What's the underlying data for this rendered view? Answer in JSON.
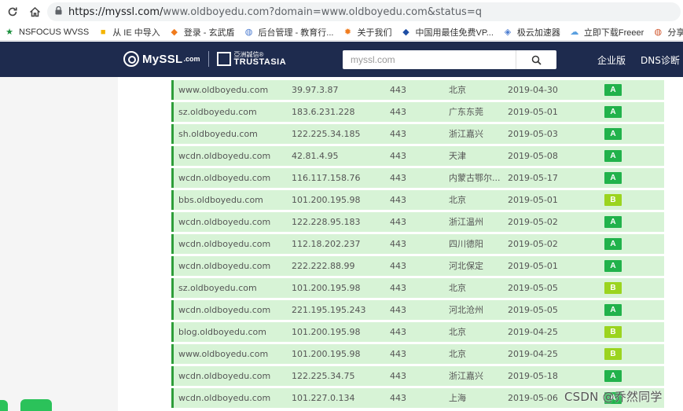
{
  "browser": {
    "url_host": "https://myssl.com/",
    "url_rest": "www.oldboyedu.com?domain=www.oldboyedu.com&status=q"
  },
  "bookmarks": [
    {
      "label": "NSFOCUS WVSS",
      "icon": "star-icon",
      "color": "#1a8f3c"
    },
    {
      "label": "从 IE 中导入",
      "icon": "folder-icon",
      "color": "#f4b400"
    },
    {
      "label": "登录 - 玄武盾",
      "icon": "shield-icon",
      "color": "#f07b1d"
    },
    {
      "label": "后台管理 - 教育行...",
      "icon": "globe-icon",
      "color": "#4a7bd0"
    },
    {
      "label": "关于我们",
      "icon": "gear-icon",
      "color": "#f07b1d"
    },
    {
      "label": "中国用最佳免费VP...",
      "icon": "shield-icon",
      "color": "#1f4fa5"
    },
    {
      "label": "极云加速器",
      "icon": "diamond-icon",
      "color": "#4a7bd0"
    },
    {
      "label": "立即下载Freeer",
      "icon": "cloud-icon",
      "color": "#5aa0e0"
    },
    {
      "label": "分享Fre",
      "icon": "globe-icon",
      "color": "#d0562d"
    }
  ],
  "header": {
    "brand": "MySSL",
    "brand_suffix": ".com",
    "trust_cn": "亞洲誠信®",
    "trust_en": "TRUSTASIA",
    "search_placeholder": "myssl.com",
    "nav": [
      "企业版",
      "DNS诊断"
    ]
  },
  "table": {
    "rows": [
      {
        "domain": "www.oldboyedu.com",
        "ip": "39.97.3.87",
        "port": "443",
        "location": "北京",
        "date": "2019-04-30",
        "grade": "A"
      },
      {
        "domain": "sz.oldboyedu.com",
        "ip": "183.6.231.228",
        "port": "443",
        "location": "广东东莞",
        "date": "2019-05-01",
        "grade": "A"
      },
      {
        "domain": "sh.oldboyedu.com",
        "ip": "122.225.34.185",
        "port": "443",
        "location": "浙江嘉兴",
        "date": "2019-05-03",
        "grade": "A"
      },
      {
        "domain": "wcdn.oldboyedu.com",
        "ip": "42.81.4.95",
        "port": "443",
        "location": "天津",
        "date": "2019-05-08",
        "grade": "A"
      },
      {
        "domain": "wcdn.oldboyedu.com",
        "ip": "116.117.158.76",
        "port": "443",
        "location": "内蒙古鄂尔...",
        "date": "2019-05-17",
        "grade": "A"
      },
      {
        "domain": "bbs.oldboyedu.com",
        "ip": "101.200.195.98",
        "port": "443",
        "location": "北京",
        "date": "2019-05-01",
        "grade": "B"
      },
      {
        "domain": "wcdn.oldboyedu.com",
        "ip": "122.228.95.183",
        "port": "443",
        "location": "浙江温州",
        "date": "2019-05-02",
        "grade": "A"
      },
      {
        "domain": "wcdn.oldboyedu.com",
        "ip": "112.18.202.237",
        "port": "443",
        "location": "四川德阳",
        "date": "2019-05-02",
        "grade": "A"
      },
      {
        "domain": "wcdn.oldboyedu.com",
        "ip": "222.222.88.99",
        "port": "443",
        "location": "河北保定",
        "date": "2019-05-01",
        "grade": "A"
      },
      {
        "domain": "sz.oldboyedu.com",
        "ip": "101.200.195.98",
        "port": "443",
        "location": "北京",
        "date": "2019-05-05",
        "grade": "B"
      },
      {
        "domain": "wcdn.oldboyedu.com",
        "ip": "221.195.195.243",
        "port": "443",
        "location": "河北沧州",
        "date": "2019-05-05",
        "grade": "A"
      },
      {
        "domain": "blog.oldboyedu.com",
        "ip": "101.200.195.98",
        "port": "443",
        "location": "北京",
        "date": "2019-04-25",
        "grade": "B"
      },
      {
        "domain": "www.oldboyedu.com",
        "ip": "101.200.195.98",
        "port": "443",
        "location": "北京",
        "date": "2019-04-25",
        "grade": "B"
      },
      {
        "domain": "wcdn.oldboyedu.com",
        "ip": "122.225.34.75",
        "port": "443",
        "location": "浙江嘉兴",
        "date": "2019-05-18",
        "grade": "A"
      },
      {
        "domain": "wcdn.oldboyedu.com",
        "ip": "101.227.0.134",
        "port": "443",
        "location": "上海",
        "date": "2019-05-06",
        "grade": "A"
      }
    ]
  },
  "overlay": {
    "watermark": "CSDN @乔然同学"
  },
  "colors": {
    "header_bg": "#1e2b4e",
    "row_bg": "#d7f3d6",
    "row_border": "#2e9e3a",
    "grade_A": "#21b24b",
    "grade_B": "#9bd41f"
  }
}
